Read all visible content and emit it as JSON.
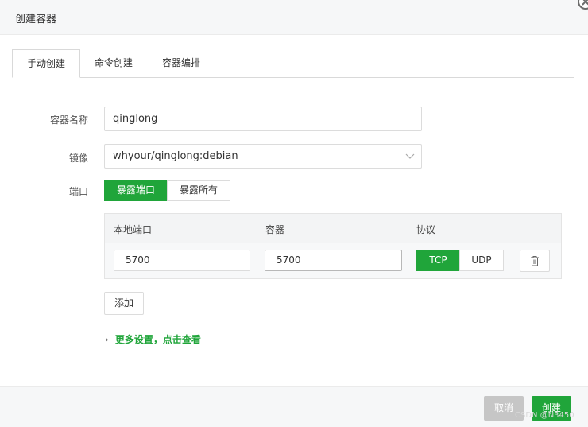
{
  "dialog": {
    "title": "创建容器"
  },
  "tabs": [
    {
      "label": "手动创建",
      "active": true
    },
    {
      "label": "命令创建",
      "active": false
    },
    {
      "label": "容器编排",
      "active": false
    }
  ],
  "form": {
    "name_label": "容器名称",
    "name_value": "qinglong",
    "image_label": "镜像",
    "image_value": "whyour/qinglong:debian",
    "port_label": "端口",
    "port_modes": [
      {
        "label": "暴露端口",
        "selected": true
      },
      {
        "label": "暴露所有",
        "selected": false
      }
    ]
  },
  "port_table": {
    "headers": [
      "本地端口",
      "容器",
      "协议"
    ],
    "rows": [
      {
        "local": "5700",
        "container": "5700",
        "protocols": [
          {
            "label": "TCP",
            "selected": true
          },
          {
            "label": "UDP",
            "selected": false
          }
        ]
      }
    ],
    "add_label": "添加"
  },
  "more_settings": {
    "label": "更多设置，点击查看"
  },
  "footer": {
    "cancel_label": "取消",
    "create_label": "创建",
    "watermark": "CSDN @N3450"
  },
  "colors": {
    "accent": "#20a53a",
    "cancel_bg": "#c6c6c6"
  },
  "icons": {
    "close": "close-icon",
    "chevron": "chevron-down-icon",
    "trash": "trash-icon",
    "expand": "chevron-right-icon"
  }
}
